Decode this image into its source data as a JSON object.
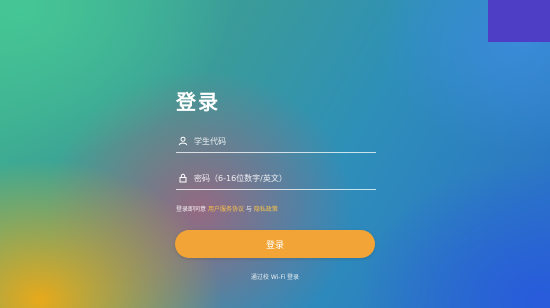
{
  "login": {
    "title": "登录",
    "username_placeholder": "学生代码",
    "password_placeholder": "密码（6-16位数字/英文）",
    "agreement": {
      "prefix": "登录即同意",
      "terms_link": "用户服务协议",
      "conjunction": "与",
      "privacy_link": "隐私政策"
    },
    "submit_label": "登录",
    "wifi_login_label": "通过校 Wi-Fi 登录"
  },
  "icons": {
    "username": "user-icon",
    "password": "lock-icon"
  },
  "colors": {
    "button": "#f2a536",
    "link": "#f6c24a"
  }
}
